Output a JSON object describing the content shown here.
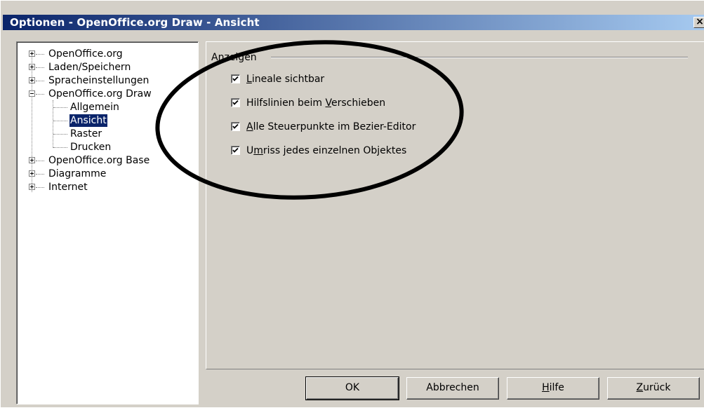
{
  "window": {
    "title": "Optionen - OpenOffice.org Draw - Ansicht",
    "close_glyph": "×"
  },
  "tree": {
    "items": [
      {
        "label": "OpenOffice.org",
        "expander": "plus"
      },
      {
        "label": "Laden/Speichern",
        "expander": "plus"
      },
      {
        "label": "Spracheinstellungen",
        "expander": "plus"
      },
      {
        "label": "OpenOffice.org Draw",
        "expander": "minus"
      },
      {
        "label": "Allgemein"
      },
      {
        "label": "Ansicht",
        "selected": true
      },
      {
        "label": "Raster"
      },
      {
        "label": "Drucken"
      },
      {
        "label": "OpenOffice.org Base",
        "expander": "plus"
      },
      {
        "label": "Diagramme",
        "expander": "plus"
      },
      {
        "label": "Internet",
        "expander": "plus"
      }
    ]
  },
  "group": {
    "label": "Anzeigen",
    "checkboxes": [
      {
        "label_pre": "",
        "accel": "L",
        "label_post": "ineale sichtbar",
        "checked": true
      },
      {
        "label_pre": "Hilfslinien beim ",
        "accel": "V",
        "label_post": "erschieben",
        "checked": true
      },
      {
        "label_pre": "",
        "accel": "A",
        "label_post": "lle Steuerpunkte im Bezier-Editor",
        "checked": true
      },
      {
        "label_pre": "U",
        "accel": "m",
        "label_post": "riss jedes einzelnen Objektes",
        "checked": true
      }
    ]
  },
  "buttons": {
    "ok": {
      "label_pre": "OK",
      "accel": "",
      "label_post": ""
    },
    "cancel": {
      "label_pre": "Abbrechen",
      "accel": "",
      "label_post": ""
    },
    "help": {
      "label_pre": "",
      "accel": "H",
      "label_post": "ilfe"
    },
    "back": {
      "label_pre": "",
      "accel": "Z",
      "label_post": "urück"
    }
  },
  "colors": {
    "title_bar_start": "#0a246a",
    "title_bar_end": "#a6caf0",
    "dialog_bg": "#d4d0c8",
    "selection": "#0a246a"
  }
}
